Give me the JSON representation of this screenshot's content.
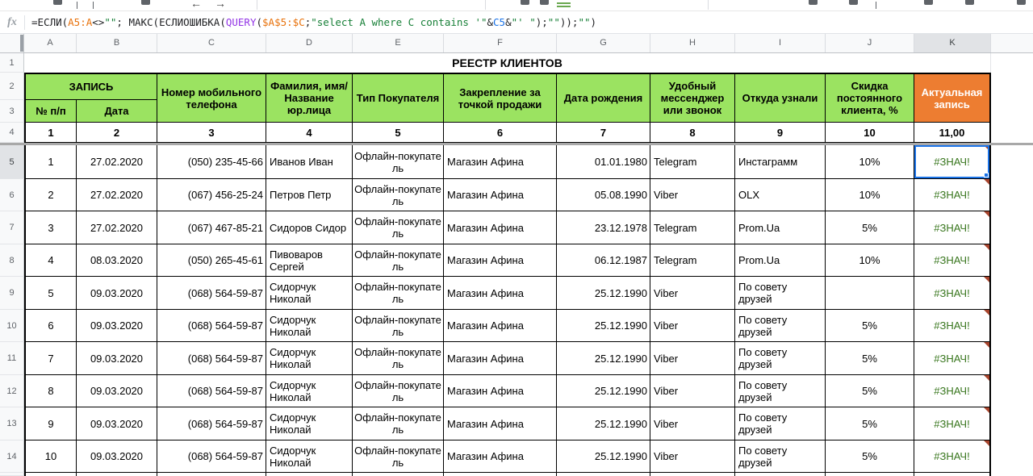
{
  "toolbar": {
    "icons": [
      {
        "name": "toolbar-icon-1"
      },
      {
        "name": "toolbar-icon-2"
      },
      {
        "name": "toolbar-icon-3"
      },
      {
        "name": "left-arrow-icon"
      },
      {
        "name": "right-arrow-icon"
      },
      {
        "name": "toolbar-icon-4"
      },
      {
        "name": "toolbar-icon-5"
      },
      {
        "name": "toolbar-icon-6"
      },
      {
        "name": "borders-green-icon"
      },
      {
        "name": "toolbar-icon-7"
      },
      {
        "name": "toolbar-icon-8"
      },
      {
        "name": "toolbar-icon-9"
      },
      {
        "name": "toolbar-icon-10"
      },
      {
        "name": "toolbar-icon-11"
      }
    ]
  },
  "formula_bar": {
    "fx_label": "fx",
    "full_formula": "=ЕСЛИ(A5:A<>\"\"; МАКС(ЕСЛИОШИБКА(QUERY($A$5:$C;\"select A where C contains '\"&C5&\"' \");\"\"));\"\")",
    "tokens": [
      {
        "t": "=ЕСЛИ(",
        "c": "k"
      },
      {
        "t": "A5:A",
        "c": "orange"
      },
      {
        "t": "<>",
        "c": "k"
      },
      {
        "t": "\"\"",
        "c": "green"
      },
      {
        "t": "; МАКС(ЕСЛИОШИБКА(",
        "c": "k"
      },
      {
        "t": "QUERY",
        "c": "purple"
      },
      {
        "t": "(",
        "c": "k"
      },
      {
        "t": "$A$5:$C",
        "c": "orange"
      },
      {
        "t": ";",
        "c": "k"
      },
      {
        "t": "\"select A where C contains '\"",
        "c": "green"
      },
      {
        "t": "&",
        "c": "k"
      },
      {
        "t": "C5",
        "c": "blue"
      },
      {
        "t": "&",
        "c": "k"
      },
      {
        "t": "\"' \"",
        "c": "green"
      },
      {
        "t": ");",
        "c": "k"
      },
      {
        "t": "\"\"",
        "c": "green"
      },
      {
        "t": "));",
        "c": "k"
      },
      {
        "t": "\"\"",
        "c": "green"
      },
      {
        "t": ")",
        "c": "k"
      }
    ]
  },
  "sheet": {
    "column_letters": [
      "A",
      "B",
      "C",
      "D",
      "E",
      "F",
      "G",
      "H",
      "I",
      "J",
      "K"
    ],
    "selected_column": "K",
    "selected_row": "5",
    "selected_cell": "K5",
    "row_numbers": [
      "1",
      "2",
      "3",
      "4",
      "5",
      "6",
      "7",
      "8",
      "9",
      "10",
      "11",
      "12",
      "13",
      "14"
    ],
    "title": "РЕЕСТР КЛИЕНТОВ",
    "headers": {
      "zapis": "ЗАПИСЬ",
      "num": "№ п/п",
      "date": "Дата",
      "phone": "Номер мобильного телефона",
      "name": "Фамилия, имя/ Название юр.лица",
      "buyer_type": "Тип Покупателя",
      "store": "Закрепление за точкой продажи",
      "birth": "Дата рождения",
      "messenger": "Удобный мессенджер или звонок",
      "source": "Откуда узнали",
      "discount": "Скидка постоянного клиента, %",
      "actual": "Актуальная запись"
    },
    "column_numbers": [
      "1",
      "2",
      "3",
      "4",
      "5",
      "6",
      "7",
      "8",
      "9",
      "10",
      "11,00"
    ],
    "rows": [
      [
        "1",
        "27.02.2020",
        "(050) 235-45-66",
        "Иванов Иван",
        "Офлайн-покупатель",
        "Магазин Афина",
        "01.01.1980",
        "Telegram",
        "Инстаграмм",
        "10%",
        "#ЗНАЧ!"
      ],
      [
        "2",
        "27.02.2020",
        "(067) 456-25-24",
        "Петров Петр",
        "Офлайн-покупатель",
        "Магазин Афина",
        "05.08.1990",
        "Viber",
        "OLX",
        "10%",
        "#ЗНАЧ!"
      ],
      [
        "3",
        "27.02.2020",
        "(067) 467-85-21",
        "Сидоров Сидор",
        "Офлайн-покупатель",
        "Магазин Афина",
        "23.12.1978",
        "Telegram",
        "Prom.Ua",
        "5%",
        "#ЗНАЧ!"
      ],
      [
        "4",
        "08.03.2020",
        "(050) 265-45-61",
        "Пивоваров Сергей",
        "Офлайн-покупатель",
        "Магазин Афина",
        "06.12.1987",
        "Telegram",
        "Prom.Ua",
        "10%",
        "#ЗНАЧ!"
      ],
      [
        "5",
        "09.03.2020",
        "(068) 564-59-87",
        "Сидорчук Николай",
        "Офлайн-покупатель",
        "Магазин Афина",
        "25.12.1990",
        "Viber",
        "По совету друзей",
        "",
        "#ЗНАЧ!"
      ],
      [
        "6",
        "09.03.2020",
        "(068) 564-59-87",
        "Сидорчук Николай",
        "Офлайн-покупатель",
        "Магазин Афина",
        "25.12.1990",
        "Viber",
        "По совету друзей",
        "5%",
        "#ЗНАЧ!"
      ],
      [
        "7",
        "09.03.2020",
        "(068) 564-59-87",
        "Сидорчук Николай",
        "Офлайн-покупатель",
        "Магазин Афина",
        "25.12.1990",
        "Viber",
        "По совету друзей",
        "5%",
        "#ЗНАЧ!"
      ],
      [
        "8",
        "09.03.2020",
        "(068) 564-59-87",
        "Сидорчук Николай",
        "Офлайн-покупатель",
        "Магазин Афина",
        "25.12.1990",
        "Viber",
        "По совету друзей",
        "5%",
        "#ЗНАЧ!"
      ],
      [
        "9",
        "09.03.2020",
        "(068) 564-59-87",
        "Сидорчук Николай",
        "Офлайн-покупатель",
        "Магазин Афина",
        "25.12.1990",
        "Viber",
        "По совету друзей",
        "5%",
        "#ЗНАЧ!"
      ],
      [
        "10",
        "09.03.2020",
        "(068) 564-59-87",
        "Сидорчук Николай",
        "Офлайн-покупатель",
        "Магазин Афина",
        "25.12.1990",
        "Viber",
        "По совету друзей",
        "5%",
        "#ЗНАЧ!"
      ]
    ],
    "error_value": "#ЗНАЧ!"
  },
  "colors": {
    "header_green": "#9be361",
    "header_orange": "#ed7d31",
    "error_text_green": "#38761d",
    "error_corner_red": "#a8452e",
    "selection_blue": "#1a73e8",
    "formula_orange": "#e8710a",
    "formula_green": "#188038",
    "formula_blue": "#1a73e8",
    "formula_purple": "#9334e6"
  }
}
